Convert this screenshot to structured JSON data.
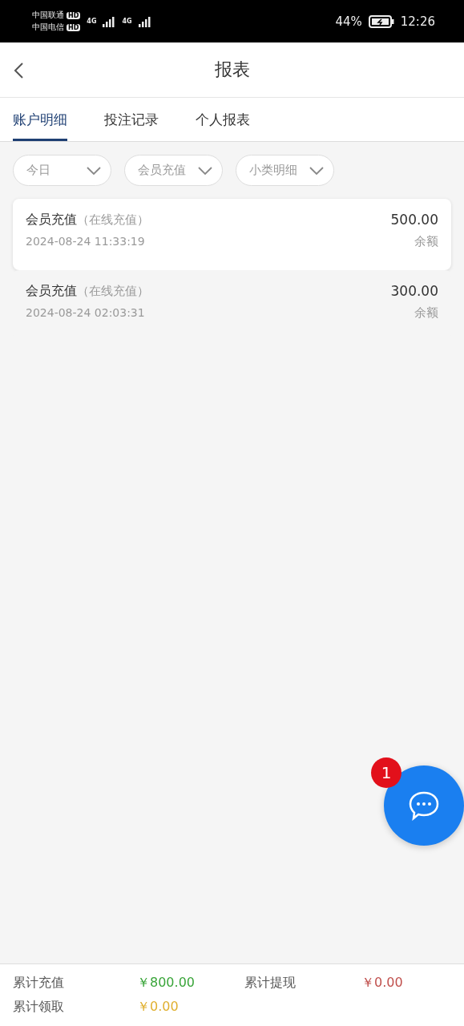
{
  "status_bar": {
    "carriers": [
      {
        "name": "中国联通",
        "tag": "HD"
      },
      {
        "name": "中国电信",
        "tag": "HD"
      }
    ],
    "networks": [
      "4G",
      "4G"
    ],
    "battery": "44%",
    "time": "12:26"
  },
  "header": {
    "title": "报表"
  },
  "tabs": [
    {
      "label": "账户明细",
      "selected": true
    },
    {
      "label": "投注记录",
      "selected": false
    },
    {
      "label": "个人报表",
      "selected": false
    }
  ],
  "filters": [
    "今日",
    "会员充值",
    "小类明细"
  ],
  "records": [
    {
      "type": "会员充值",
      "subtype": "（在线充值）",
      "time": "2024-08-24 11:33:19",
      "amount": "500.00",
      "balance_label": "余额",
      "selected": true
    },
    {
      "type": "会员充值",
      "subtype": "（在线充值）",
      "time": "2024-08-24 02:03:31",
      "amount": "300.00",
      "balance_label": "余额",
      "selected": false
    }
  ],
  "chat": {
    "badge": "1"
  },
  "summary": [
    {
      "label": "累计充值",
      "value": "￥800.00",
      "color": "#3aa53a"
    },
    {
      "label": "累计提现",
      "value": "￥0.00",
      "color": "#c0504d"
    },
    {
      "label": "累计领取",
      "value": "￥0.00",
      "color": "#e0b030"
    }
  ]
}
